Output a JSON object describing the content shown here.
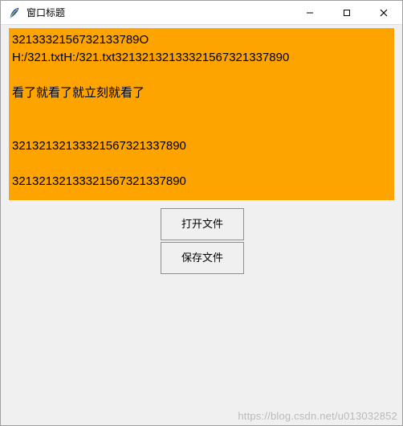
{
  "titlebar": {
    "title": "窗口标题",
    "icon_name": "tk-feather-icon"
  },
  "textarea": {
    "content": "3213332156732133789O\nH:/321.txtH:/321.txt32132132133321567321337890\n\n看了就看了就立刻就看了\n\n\n32132132133321567321337890\n\n32132132133321567321337890"
  },
  "buttons": {
    "open_label": "打开文件",
    "save_label": "保存文件"
  },
  "watermark": "https://blog.csdn.net/u013032852"
}
